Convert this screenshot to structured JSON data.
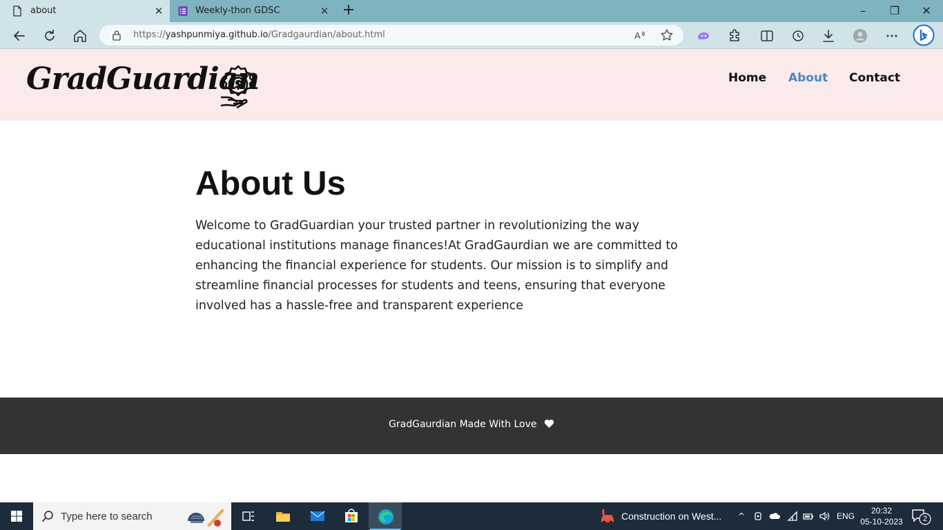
{
  "browser": {
    "tabs": [
      {
        "title": "about",
        "active": true
      },
      {
        "title": "Weekly-thon GDSC",
        "active": false
      }
    ],
    "address": {
      "scheme": "https://",
      "host": "yashpunmiya.github.io",
      "path": "/Gradgaurdian/about.html"
    }
  },
  "site": {
    "logo_text": "GradGuardian",
    "nav": [
      {
        "label": "Home",
        "active": false
      },
      {
        "label": "About",
        "active": true
      },
      {
        "label": "Contact",
        "active": false
      }
    ],
    "title": "About Us",
    "body": "Welcome to GradGuardian your trusted partner in revolutionizing the way educational institutions manage finances!At GradGaurdian we are committed to enhancing the financial experience for students. Our mission is to simplify and streamline financial processes for students and teens, ensuring that everyone involved has a hassle-free and transparent experience",
    "footer": "GradGaurdian Made With Love",
    "colors": {
      "header_bg": "#fbeaea",
      "nav_active": "#4a86c0",
      "footer_bg": "#333333"
    }
  },
  "taskbar": {
    "search_placeholder": "Type here to search",
    "news": "Construction on West...",
    "language": "ENG",
    "time": "20:32",
    "date": "05-10-2023",
    "notification_count": "2"
  },
  "icons": {
    "tab_page": "page-icon",
    "tab_form": "forms-icon",
    "back": "back-arrow-icon",
    "refresh": "refresh-icon",
    "home": "home-icon",
    "lock": "lock-icon",
    "read_aloud": "read-aloud-icon",
    "favorite": "star-icon",
    "extensions": "puzzle-icon",
    "split": "split-screen-icon",
    "history": "history-icon",
    "downloads": "download-icon",
    "profile": "avatar-icon",
    "more": "more-icon",
    "bing": "bing-chat-icon",
    "logo": "money-gear-icon",
    "heart": "heart-icon"
  }
}
